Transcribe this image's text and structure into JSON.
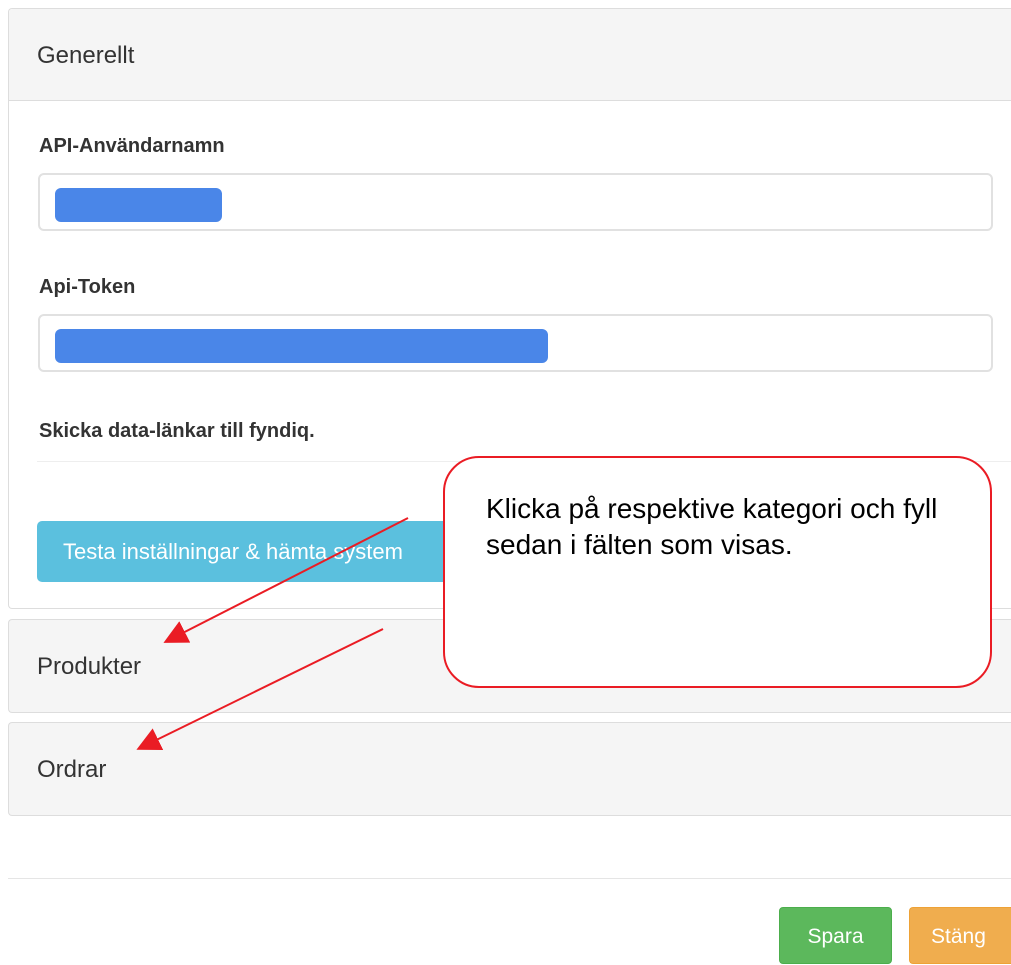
{
  "panels": {
    "general": {
      "title": "Generellt",
      "fields": {
        "api_username_label": "API-Användarnamn",
        "api_token_label": "Api-Token",
        "links_label": "Skicka data-länkar till fyndiq."
      },
      "test_button_label": "Testa inställningar & hämta system"
    },
    "products": {
      "title": "Produkter"
    },
    "orders": {
      "title": "Ordrar"
    }
  },
  "footer": {
    "save_label": "Spara",
    "close_label": "Stäng"
  },
  "annotation": {
    "text": "Klicka på respektive kategori och fyll sedan i fälten som visas.",
    "border_color": "#ea1c24",
    "arrow_color": "#ea1c24"
  },
  "colors": {
    "redaction": "#4a86e8",
    "info_button": "#5bc0de",
    "success_button": "#5cb85c",
    "warning_button": "#f0ad4e",
    "panel_heading": "#f5f5f5"
  }
}
